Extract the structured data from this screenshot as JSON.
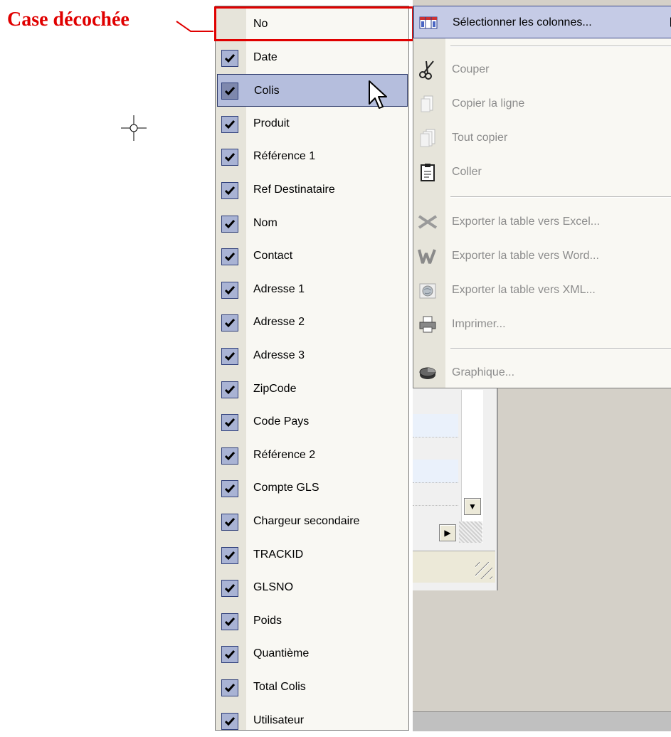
{
  "annotation": {
    "label": "Case décochée",
    "color": "#e00000"
  },
  "column_menu": {
    "items": [
      {
        "label": "No",
        "checked": false
      },
      {
        "label": "Date",
        "checked": true
      },
      {
        "label": "Colis",
        "checked": true,
        "hovered": true
      },
      {
        "label": "Produit",
        "checked": true
      },
      {
        "label": "Référence 1",
        "checked": true
      },
      {
        "label": "Ref Destinataire",
        "checked": true
      },
      {
        "label": "Nom",
        "checked": true
      },
      {
        "label": "Contact",
        "checked": true
      },
      {
        "label": "Adresse 1",
        "checked": true
      },
      {
        "label": "Adresse 2",
        "checked": true
      },
      {
        "label": "Adresse 3",
        "checked": true
      },
      {
        "label": "ZipCode",
        "checked": true
      },
      {
        "label": "Code Pays",
        "checked": true
      },
      {
        "label": "Référence 2",
        "checked": true
      },
      {
        "label": "Compte GLS",
        "checked": true
      },
      {
        "label": "Chargeur secondaire",
        "checked": true
      },
      {
        "label": "TRACKID",
        "checked": true
      },
      {
        "label": "GLSNO",
        "checked": true
      },
      {
        "label": "Poids",
        "checked": true
      },
      {
        "label": "Quantième",
        "checked": true
      },
      {
        "label": "Total Colis",
        "checked": true
      },
      {
        "label": "Utilisateur",
        "checked": true
      }
    ]
  },
  "context_menu": {
    "select_columns": {
      "label": "Sélectionner les colonnes...",
      "icon": "columns-icon",
      "enabled": true
    },
    "cut": {
      "label": "Couper",
      "icon": "scissors-icon",
      "enabled": false
    },
    "copy_row": {
      "label": "Copier la ligne",
      "icon": "copy-icon",
      "enabled": false
    },
    "copy_all": {
      "label": "Tout copier",
      "icon": "copy-all-icon",
      "enabled": false
    },
    "paste": {
      "label": "Coller",
      "icon": "clipboard-icon",
      "enabled": false
    },
    "export_excel": {
      "label": "Exporter la table vers Excel...",
      "icon": "excel-icon",
      "enabled": false
    },
    "export_word": {
      "label": "Exporter la table vers Word...",
      "icon": "word-icon",
      "enabled": false
    },
    "export_xml": {
      "label": "Exporter la table vers XML...",
      "icon": "xml-globe-icon",
      "enabled": false
    },
    "print": {
      "label": "Imprimer...",
      "icon": "printer-icon",
      "enabled": false
    },
    "chart": {
      "label": "Graphique...",
      "icon": "chart-icon",
      "enabled": false
    }
  },
  "colors": {
    "checkbox_fill": "#a9b3d4",
    "hover_fill": "#b5bedd",
    "disabled_text": "#8c8c8c",
    "menu_bg": "#f9f8f3"
  }
}
